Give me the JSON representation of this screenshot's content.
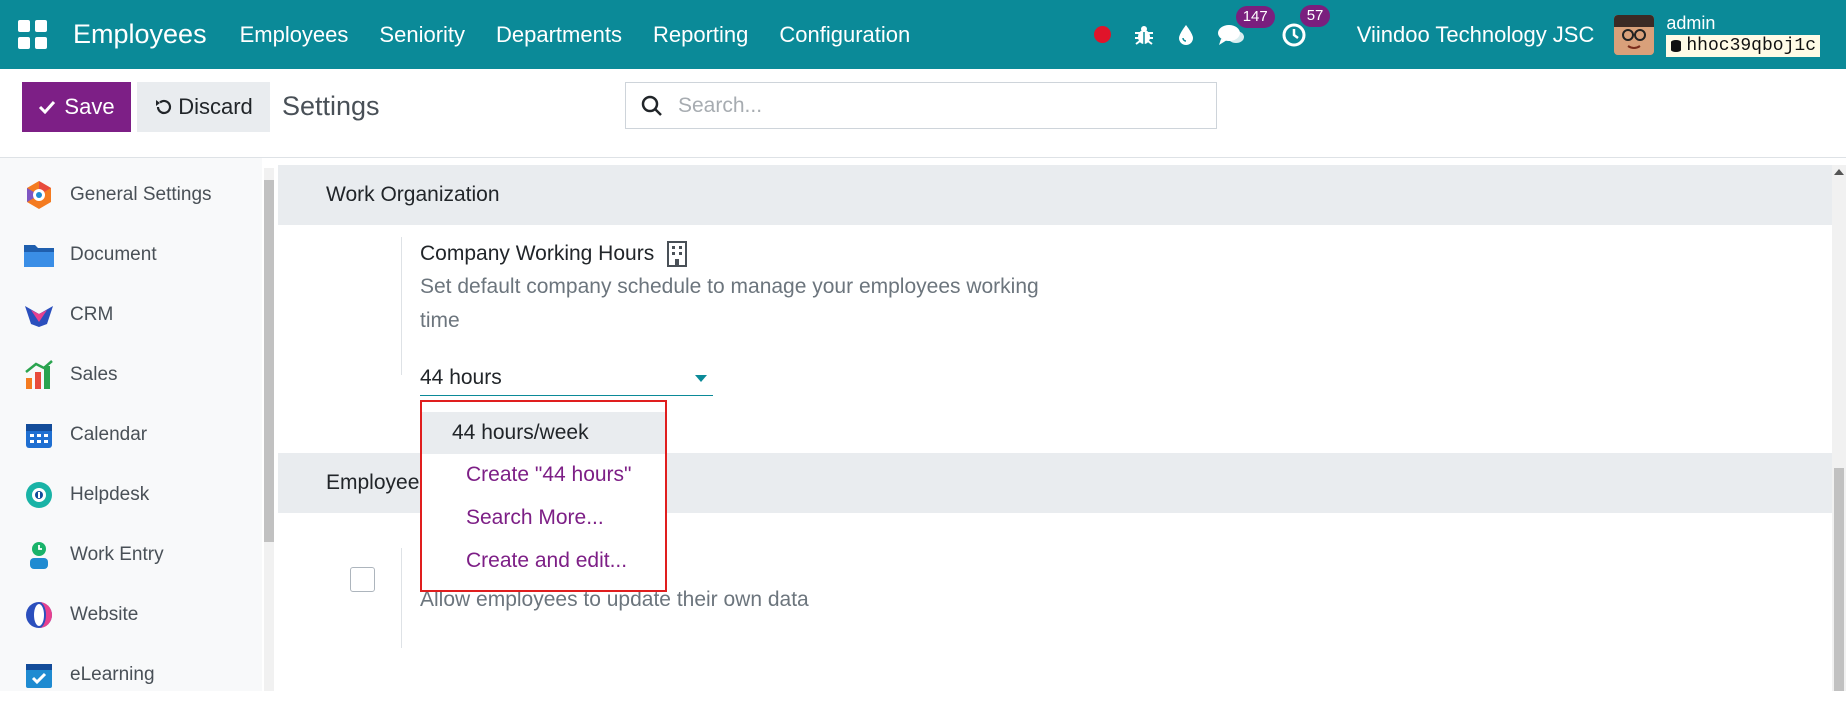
{
  "navbar": {
    "app_title": "Employees",
    "menu": [
      "Employees",
      "Seniority",
      "Departments",
      "Reporting",
      "Configuration"
    ],
    "messages_badge": "147",
    "activities_badge": "57",
    "company": "Viindoo Technology JSC",
    "user_name": "admin",
    "db_name": "hhoc39qboj1c",
    "icons": [
      "apps-grid-icon",
      "record-dot-icon",
      "bug-icon",
      "drop-icon",
      "chat-icon",
      "clock-icon",
      "database-icon"
    ]
  },
  "control_panel": {
    "save_label": "Save",
    "discard_label": "Discard",
    "title": "Settings",
    "search_placeholder": "Search..."
  },
  "sidebar": {
    "items": [
      {
        "label": "General Settings",
        "icon": "general-settings-icon"
      },
      {
        "label": "Document",
        "icon": "folder-icon"
      },
      {
        "label": "CRM",
        "icon": "crm-icon"
      },
      {
        "label": "Sales",
        "icon": "sales-chart-icon"
      },
      {
        "label": "Calendar",
        "icon": "calendar-icon"
      },
      {
        "label": "Helpdesk",
        "icon": "headset-icon"
      },
      {
        "label": "Work Entry",
        "icon": "work-entry-icon"
      },
      {
        "label": "Website",
        "icon": "website-icon"
      },
      {
        "label": "eLearning",
        "icon": "elearning-icon"
      }
    ]
  },
  "main": {
    "section_work": "Work Organization",
    "working_hours_title": "Company Working Hours",
    "working_hours_desc": "Set default company schedule to manage your employees working time",
    "working_hours_value": "44 hours",
    "section_employee": "Employee",
    "employee_desc": "Allow employees to update their own data"
  },
  "dropdown": {
    "items": [
      "44 hours/week",
      "Create \"44 hours\"",
      "Search More...",
      "Create and edit..."
    ]
  },
  "colors": {
    "navbar": "#0b8a98",
    "primary": "#7d1f86",
    "highlight_border": "#e01e1e"
  }
}
